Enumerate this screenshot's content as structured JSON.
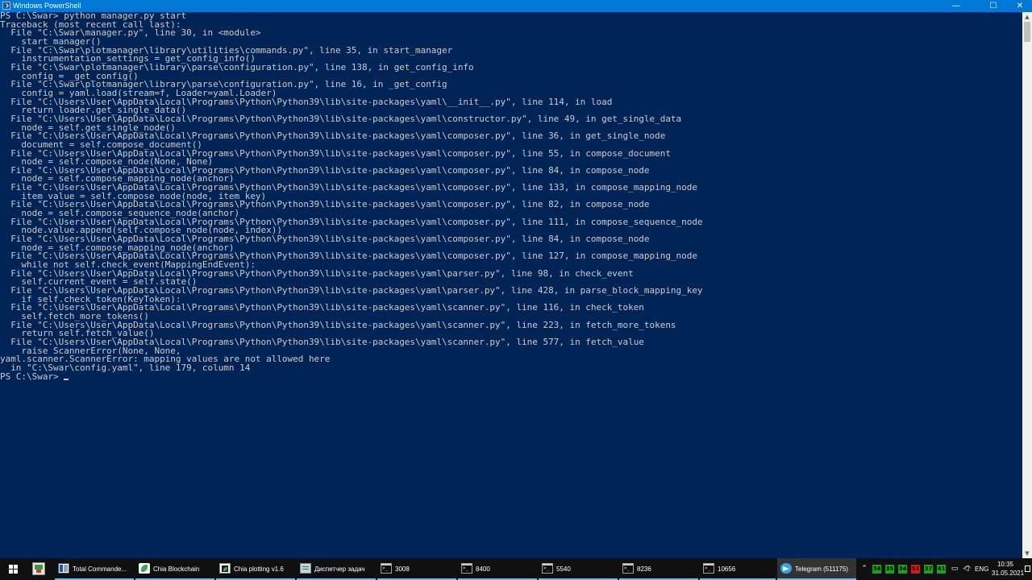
{
  "window": {
    "title": "Windows PowerShell",
    "minimize_glyph": "—",
    "maximize_glyph": "☐",
    "close_glyph": "✕"
  },
  "console": {
    "lines": [
      "PS C:\\Swar> python manager.py start",
      "Traceback (most recent call last):",
      "  File \"C:\\Swar\\manager.py\", line 30, in <module>",
      "    start_manager()",
      "  File \"C:\\Swar\\plotmanager\\library\\utilities\\commands.py\", line 35, in start_manager",
      "    instrumentation_settings = get_config_info()",
      "  File \"C:\\Swar\\plotmanager\\library\\parse\\configuration.py\", line 138, in get_config_info",
      "    config = _get_config()",
      "  File \"C:\\Swar\\plotmanager\\library\\parse\\configuration.py\", line 16, in _get_config",
      "    config = yaml.load(stream=f, Loader=yaml.Loader)",
      "  File \"C:\\Users\\User\\AppData\\Local\\Programs\\Python\\Python39\\lib\\site-packages\\yaml\\__init__.py\", line 114, in load",
      "    return loader.get_single_data()",
      "  File \"C:\\Users\\User\\AppData\\Local\\Programs\\Python\\Python39\\lib\\site-packages\\yaml\\constructor.py\", line 49, in get_single_data",
      "    node = self.get_single_node()",
      "  File \"C:\\Users\\User\\AppData\\Local\\Programs\\Python\\Python39\\lib\\site-packages\\yaml\\composer.py\", line 36, in get_single_node",
      "    document = self.compose_document()",
      "  File \"C:\\Users\\User\\AppData\\Local\\Programs\\Python\\Python39\\lib\\site-packages\\yaml\\composer.py\", line 55, in compose_document",
      "    node = self.compose_node(None, None)",
      "  File \"C:\\Users\\User\\AppData\\Local\\Programs\\Python\\Python39\\lib\\site-packages\\yaml\\composer.py\", line 84, in compose_node",
      "    node = self.compose_mapping_node(anchor)",
      "  File \"C:\\Users\\User\\AppData\\Local\\Programs\\Python\\Python39\\lib\\site-packages\\yaml\\composer.py\", line 133, in compose_mapping_node",
      "    item_value = self.compose_node(node, item_key)",
      "  File \"C:\\Users\\User\\AppData\\Local\\Programs\\Python\\Python39\\lib\\site-packages\\yaml\\composer.py\", line 82, in compose_node",
      "    node = self.compose_sequence_node(anchor)",
      "  File \"C:\\Users\\User\\AppData\\Local\\Programs\\Python\\Python39\\lib\\site-packages\\yaml\\composer.py\", line 111, in compose_sequence_node",
      "    node.value.append(self.compose_node(node, index))",
      "  File \"C:\\Users\\User\\AppData\\Local\\Programs\\Python\\Python39\\lib\\site-packages\\yaml\\composer.py\", line 84, in compose_node",
      "    node = self.compose_mapping_node(anchor)",
      "  File \"C:\\Users\\User\\AppData\\Local\\Programs\\Python\\Python39\\lib\\site-packages\\yaml\\composer.py\", line 127, in compose_mapping_node",
      "    while not self.check_event(MappingEndEvent):",
      "  File \"C:\\Users\\User\\AppData\\Local\\Programs\\Python\\Python39\\lib\\site-packages\\yaml\\parser.py\", line 98, in check_event",
      "    self.current_event = self.state()",
      "  File \"C:\\Users\\User\\AppData\\Local\\Programs\\Python\\Python39\\lib\\site-packages\\yaml\\parser.py\", line 428, in parse_block_mapping_key",
      "    if self.check_token(KeyToken):",
      "  File \"C:\\Users\\User\\AppData\\Local\\Programs\\Python\\Python39\\lib\\site-packages\\yaml\\scanner.py\", line 116, in check_token",
      "    self.fetch_more_tokens()",
      "  File \"C:\\Users\\User\\AppData\\Local\\Programs\\Python\\Python39\\lib\\site-packages\\yaml\\scanner.py\", line 223, in fetch_more_tokens",
      "    return self.fetch_value()",
      "  File \"C:\\Users\\User\\AppData\\Local\\Programs\\Python\\Python39\\lib\\site-packages\\yaml\\scanner.py\", line 577, in fetch_value",
      "    raise ScannerError(None, None,",
      "yaml.scanner.ScannerError: mapping values are not allowed here",
      "  in \"C:\\Swar\\config.yaml\", line 179, column 14"
    ],
    "prompt": "PS C:\\Swar> "
  },
  "colors": {
    "console_bg": "#012456",
    "console_fg": "#cccccc",
    "titlebar_bg": "#0078d7",
    "taskbar_bg": "#101010"
  },
  "taskbar": {
    "items": [
      {
        "label": "Total Commande...",
        "icon": "total-commander-icon",
        "active": false
      },
      {
        "label": "Chia Blockchain",
        "icon": "chia-icon",
        "active": false
      },
      {
        "label": "Chia plotting v1.6",
        "icon": "chia-plotting-icon",
        "active": false
      },
      {
        "label": "Диспетчер задач",
        "icon": "task-manager-icon",
        "active": false
      },
      {
        "label": "3008",
        "icon": "console-icon",
        "active": false
      },
      {
        "label": "8400",
        "icon": "console-icon",
        "active": false
      },
      {
        "label": "5540",
        "icon": "console-icon",
        "active": false
      },
      {
        "label": "8236",
        "icon": "console-icon",
        "active": false
      },
      {
        "label": "10656",
        "icon": "console-icon",
        "active": false
      },
      {
        "label": "Telegram (511175)",
        "icon": "telegram-icon",
        "active": true
      }
    ],
    "tray_badges": [
      "34",
      "35",
      "34",
      "51",
      "37",
      "41"
    ],
    "language": "ENG",
    "time": "10:35",
    "date": "31.05.2021"
  }
}
